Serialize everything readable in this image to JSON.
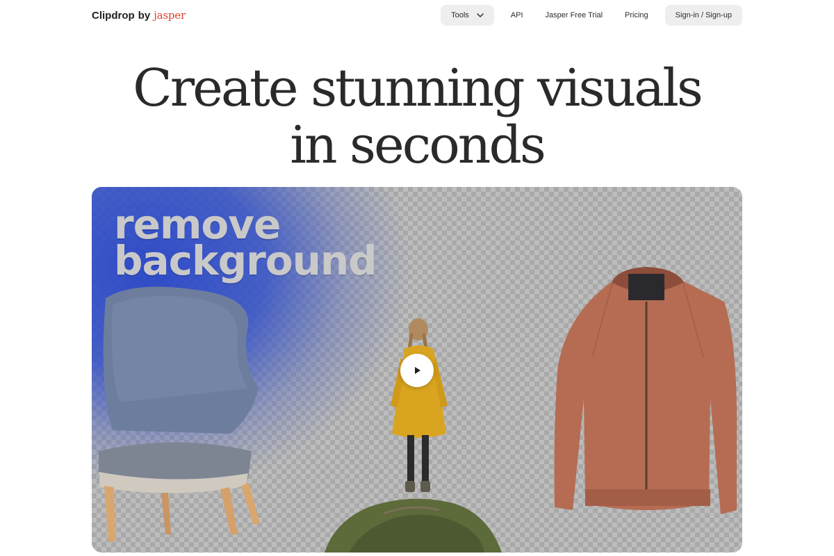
{
  "header": {
    "logo_main": "Clipdrop",
    "logo_by": "by",
    "logo_brand": "jasper",
    "nav": {
      "tools": "Tools",
      "api": "API",
      "trial": "Jasper Free Trial",
      "pricing": "Pricing",
      "signin": "Sign-in / Sign-up"
    }
  },
  "hero": {
    "title_line1": "Create stunning visuals",
    "title_line2": "in seconds"
  },
  "media": {
    "caption_line1": "remove",
    "caption_line2": "background",
    "play_icon": "play-icon"
  },
  "colors": {
    "brand_red": "#e0402a",
    "nav_pill": "#eeeeee",
    "title": "#2a2a2a"
  }
}
